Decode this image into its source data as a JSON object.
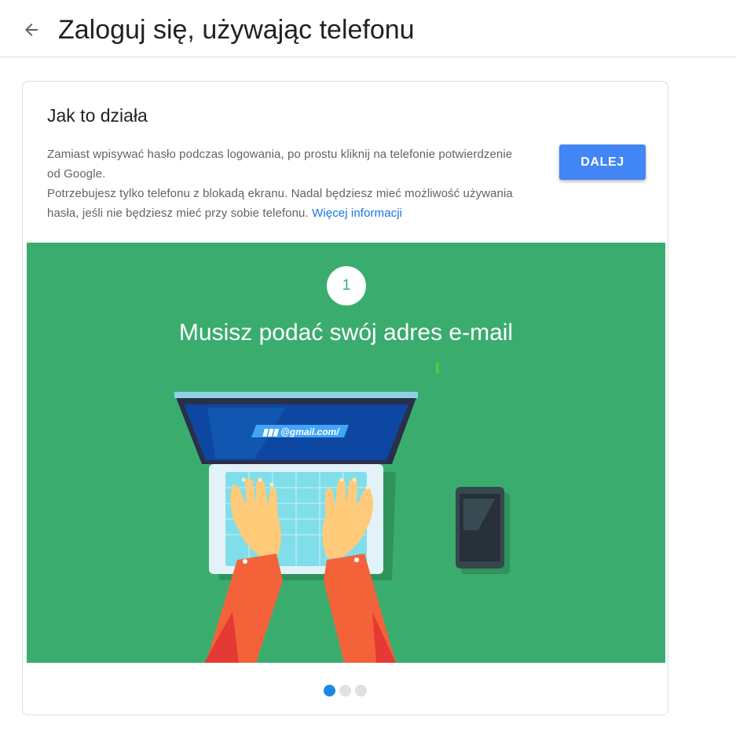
{
  "header": {
    "title": "Zaloguj się, używając telefonu"
  },
  "card": {
    "title": "Jak to działa",
    "desc_line1": "Zamiast wpisywać hasło podczas logowania, po prostu kliknij na telefonie potwierdzenie od Google.",
    "desc_line2": "Potrzebujesz tylko telefonu z blokadą ekranu. Nadal będziesz mieć możliwość używania hasła, jeśli nie będziesz mieć przy sobie telefonu.",
    "learn_more": "Więcej informacji",
    "next_button": "DALEJ"
  },
  "slide": {
    "step_number": "1",
    "step_text": "Musisz podać swój adres e-mail",
    "screen_text": "@gmail.com/",
    "background_color": "#3aad6e"
  },
  "carousel": {
    "total_slides": 3,
    "active_slide": 1
  },
  "colors": {
    "accent": "#4285f4",
    "link": "#1a73e8",
    "dot_active": "#1e88e5"
  }
}
